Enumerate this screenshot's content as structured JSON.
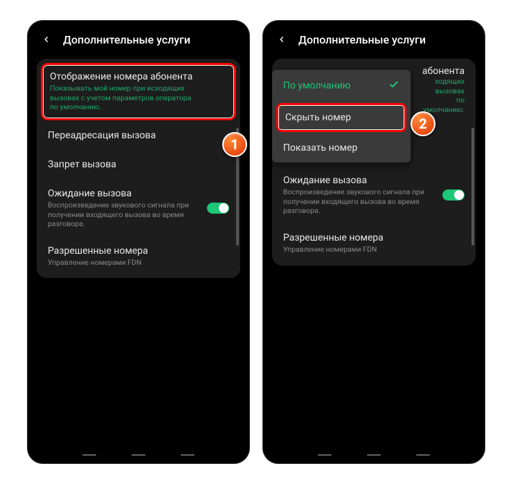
{
  "header": {
    "title": "Дополнительные услуги"
  },
  "settings": {
    "caller_id": {
      "title": "Отображение номера абонента",
      "desc": "Показывать мой номер при исходящих вызовах с учетом параметров оператора по умолчанию."
    },
    "call_forwarding": {
      "title": "Переадресация вызова"
    },
    "call_barring": {
      "title": "Запрет вызова"
    },
    "call_waiting": {
      "title": "Ожидание вызова",
      "desc": "Воспроизведение звукового сигнала при получении входящего вызова во время разговора."
    },
    "fixed_dialing": {
      "title": "Разрешенные номера",
      "desc": "Управление номерами FDN"
    }
  },
  "popup": {
    "default": "По умолчанию",
    "hide": "Скрыть номер",
    "show": "Показать номер"
  },
  "right_bg": {
    "title_end": "абонента",
    "desc_line1": "ходящих вызовах",
    "desc_line2": "по умолчанию."
  },
  "steps": {
    "one": "1",
    "two": "2"
  }
}
